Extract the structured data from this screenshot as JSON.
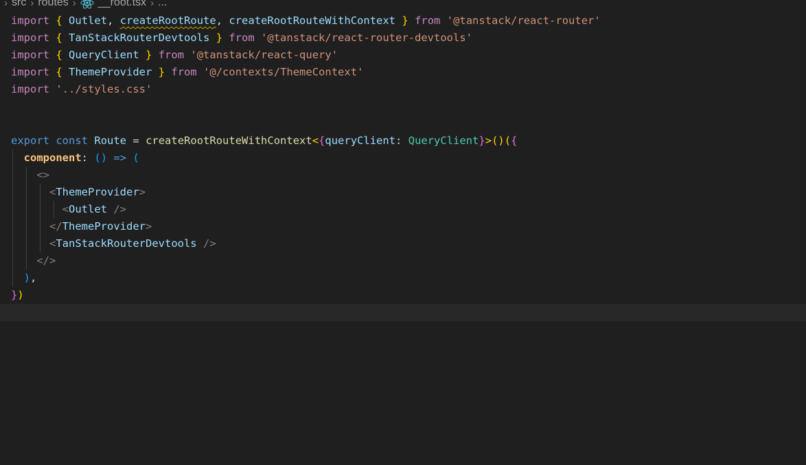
{
  "breadcrumb": {
    "items": [
      "src",
      "routes",
      "__root.tsx",
      "..."
    ]
  },
  "code": {
    "l1": {
      "import": "import",
      "b_open": "{",
      "outlet": "Outlet",
      "comma1": ",",
      "createRootRoute": "createRootRoute",
      "comma2": ",",
      "createRootRouteWithContext": "createRootRouteWithContext",
      "b_close": "}",
      "from": "from",
      "module": "'@tanstack/react-router'"
    },
    "l2": {
      "import": "import",
      "b_open": "{",
      "name": "TanStackRouterDevtools",
      "b_close": "}",
      "from": "from",
      "module": "'@tanstack/react-router-devtools'"
    },
    "l3": {
      "import": "import",
      "b_open": "{",
      "name": "QueryClient",
      "b_close": "}",
      "from": "from",
      "module": "'@tanstack/react-query'"
    },
    "l4": {
      "import": "import",
      "b_open": "{",
      "name": "ThemeProvider",
      "b_close": "}",
      "from": "from",
      "module": "'@/contexts/ThemeContext'"
    },
    "l5": {
      "import": "import",
      "module": "'../styles.css'"
    },
    "l8": {
      "export": "export",
      "const": "const",
      "route": "Route",
      "eq": "=",
      "fn": "createRootRouteWithContext",
      "lt": "<",
      "b_open": "{",
      "key": "queryClient",
      "colon": ":",
      "type": "QueryClient",
      "b_close": "}",
      "gt": ">",
      "p_open": "(",
      "p_close": ")",
      "p_open2": "(",
      "obj_open": "{"
    },
    "l9": {
      "key": "component",
      "colon": ":",
      "params": "()",
      "arrow": "=>",
      "p_open": "("
    },
    "l10": {
      "frag_open": "<>"
    },
    "l11": {
      "lt": "<",
      "tag": "ThemeProvider",
      "gt": ">"
    },
    "l12": {
      "lt": "<",
      "tag": "Outlet",
      "end": "/>"
    },
    "l13": {
      "lt": "</",
      "tag": "ThemeProvider",
      "gt": ">"
    },
    "l14": {
      "lt": "<",
      "tag": "TanStackRouterDevtools",
      "end": "/>"
    },
    "l15": {
      "frag_close": "</>"
    },
    "l16": {
      "p_close": ")",
      "comma": ","
    },
    "l17": {
      "obj_close": "}",
      "p_close": ")"
    }
  },
  "colors": {
    "background": "#1f1f1f",
    "current_line": "#282828",
    "keyword": "#c586c0",
    "storage": "#569cd6",
    "string": "#ce9178",
    "function": "#dcdcaa",
    "type": "#4ec9b0",
    "variable": "#9cdcfe",
    "bracket_gold": "#ffd700",
    "bracket_orchid": "#da70d6",
    "bracket_blue": "#179fff",
    "warning_squiggle": "#cca700"
  }
}
